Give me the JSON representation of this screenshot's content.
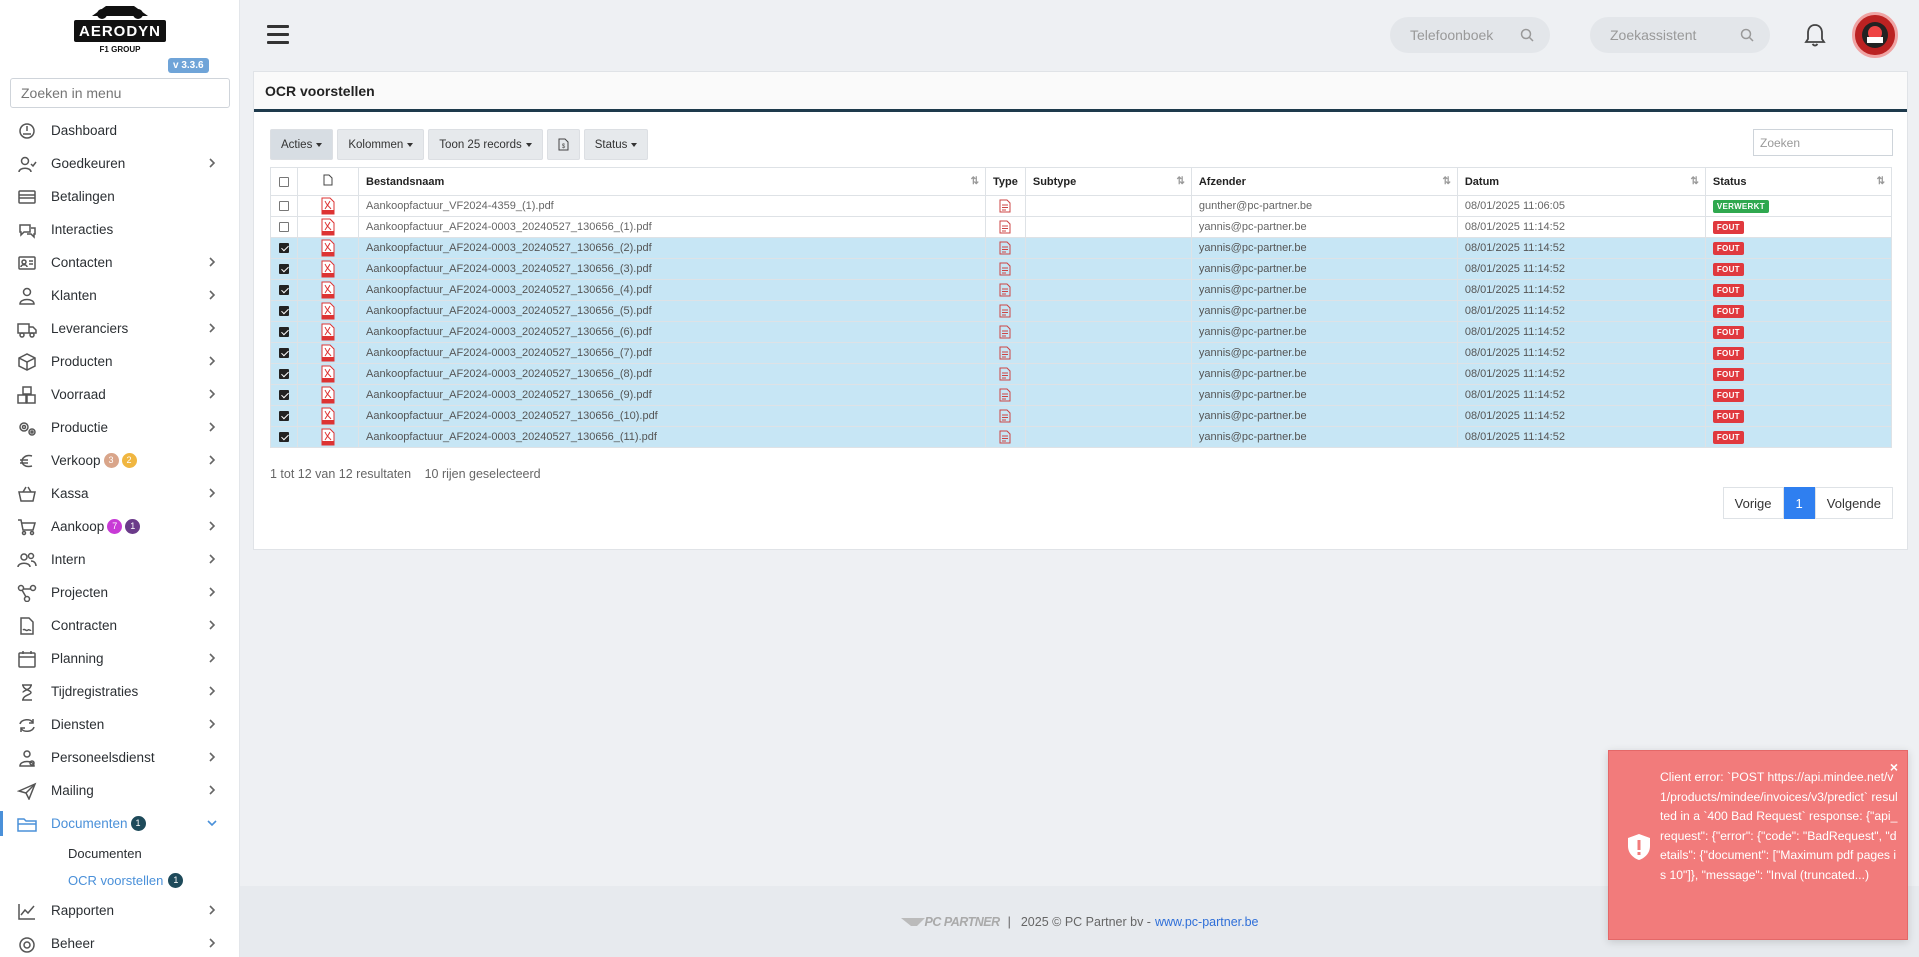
{
  "app": {
    "logo_text": "AERODYN",
    "logo_sub": "F1 GROUP",
    "version": "v 3.3.6"
  },
  "sidebar": {
    "search_placeholder": "Zoeken in menu",
    "items": [
      {
        "label": "Dashboard",
        "icon": "dashboard-icon"
      },
      {
        "label": "Goedkeuren",
        "icon": "user-check-icon"
      },
      {
        "label": "Betalingen",
        "icon": "credit-card-icon"
      },
      {
        "label": "Interacties",
        "icon": "chat-icon"
      },
      {
        "label": "Contacten",
        "icon": "contact-card-icon"
      },
      {
        "label": "Klanten",
        "icon": "user-icon"
      },
      {
        "label": "Leveranciers",
        "icon": "truck-icon"
      },
      {
        "label": "Producten",
        "icon": "box-icon"
      },
      {
        "label": "Voorraad",
        "icon": "boxes-icon"
      },
      {
        "label": "Productie",
        "icon": "gears-icon"
      },
      {
        "label": "Verkoop",
        "icon": "euro-icon",
        "badges": [
          "3",
          "2"
        ]
      },
      {
        "label": "Kassa",
        "icon": "basket-icon"
      },
      {
        "label": "Aankoop",
        "icon": "cart-icon",
        "badges": [
          "7",
          "1"
        ]
      },
      {
        "label": "Intern",
        "icon": "users-icon"
      },
      {
        "label": "Projecten",
        "icon": "project-icon"
      },
      {
        "label": "Contracten",
        "icon": "contract-icon"
      },
      {
        "label": "Planning",
        "icon": "calendar-icon"
      },
      {
        "label": "Tijdregistraties",
        "icon": "clock-icon"
      },
      {
        "label": "Diensten",
        "icon": "refresh-icon"
      },
      {
        "label": "Personeelsdienst",
        "icon": "staff-icon"
      },
      {
        "label": "Mailing",
        "icon": "send-icon"
      },
      {
        "label": "Documenten",
        "icon": "folder-icon",
        "badges": [
          "1"
        ]
      }
    ],
    "sub_items": [
      {
        "label": "Documenten"
      },
      {
        "label": "OCR voorstellen",
        "badge": "1"
      }
    ],
    "after_items": [
      {
        "label": "Rapporten",
        "icon": "chart-line-icon"
      },
      {
        "label": "Beheer",
        "icon": "settings-icon"
      }
    ],
    "badge_colors": {
      "verkoop_1": "#d9a58a",
      "verkoop_2": "#f0b640",
      "aankoop_1": "#c83ad6",
      "aankoop_2": "#6b3b8a",
      "documenten": "#1e4a5a"
    }
  },
  "topbar": {
    "phonebook_placeholder": "Telefoonboek",
    "assistant_placeholder": "Zoekassistent"
  },
  "card": {
    "title": "OCR voorstellen",
    "toolbar": {
      "actions": "Acties",
      "columns": "Kolommen",
      "show": "Toon 25 records",
      "status": "Status"
    },
    "search_placeholder": "Zoeken",
    "columns": [
      "Bestandsnaam",
      "Type",
      "Subtype",
      "Afzender",
      "Datum",
      "Status"
    ],
    "rows": [
      {
        "checked": false,
        "file": "Aankoopfactuur_VF2024-4359_(1).pdf",
        "subtype": "",
        "sender": "gunther@pc-partner.be",
        "date": "08/01/2025 11:06:05",
        "status": "VERWERKT",
        "status_kind": "ok"
      },
      {
        "checked": false,
        "file": "Aankoopfactuur_AF2024-0003_20240527_130656_(1).pdf",
        "subtype": "",
        "sender": "yannis@pc-partner.be",
        "date": "08/01/2025 11:14:52",
        "status": "FOUT",
        "status_kind": "err"
      },
      {
        "checked": true,
        "file": "Aankoopfactuur_AF2024-0003_20240527_130656_(2).pdf",
        "subtype": "",
        "sender": "yannis@pc-partner.be",
        "date": "08/01/2025 11:14:52",
        "status": "FOUT",
        "status_kind": "err"
      },
      {
        "checked": true,
        "file": "Aankoopfactuur_AF2024-0003_20240527_130656_(3).pdf",
        "subtype": "",
        "sender": "yannis@pc-partner.be",
        "date": "08/01/2025 11:14:52",
        "status": "FOUT",
        "status_kind": "err"
      },
      {
        "checked": true,
        "file": "Aankoopfactuur_AF2024-0003_20240527_130656_(4).pdf",
        "subtype": "",
        "sender": "yannis@pc-partner.be",
        "date": "08/01/2025 11:14:52",
        "status": "FOUT",
        "status_kind": "err"
      },
      {
        "checked": true,
        "file": "Aankoopfactuur_AF2024-0003_20240527_130656_(5).pdf",
        "subtype": "",
        "sender": "yannis@pc-partner.be",
        "date": "08/01/2025 11:14:52",
        "status": "FOUT",
        "status_kind": "err"
      },
      {
        "checked": true,
        "file": "Aankoopfactuur_AF2024-0003_20240527_130656_(6).pdf",
        "subtype": "",
        "sender": "yannis@pc-partner.be",
        "date": "08/01/2025 11:14:52",
        "status": "FOUT",
        "status_kind": "err"
      },
      {
        "checked": true,
        "file": "Aankoopfactuur_AF2024-0003_20240527_130656_(7).pdf",
        "subtype": "",
        "sender": "yannis@pc-partner.be",
        "date": "08/01/2025 11:14:52",
        "status": "FOUT",
        "status_kind": "err"
      },
      {
        "checked": true,
        "file": "Aankoopfactuur_AF2024-0003_20240527_130656_(8).pdf",
        "subtype": "",
        "sender": "yannis@pc-partner.be",
        "date": "08/01/2025 11:14:52",
        "status": "FOUT",
        "status_kind": "err"
      },
      {
        "checked": true,
        "file": "Aankoopfactuur_AF2024-0003_20240527_130656_(9).pdf",
        "subtype": "",
        "sender": "yannis@pc-partner.be",
        "date": "08/01/2025 11:14:52",
        "status": "FOUT",
        "status_kind": "err"
      },
      {
        "checked": true,
        "file": "Aankoopfactuur_AF2024-0003_20240527_130656_(10).pdf",
        "subtype": "",
        "sender": "yannis@pc-partner.be",
        "date": "08/01/2025 11:14:52",
        "status": "FOUT",
        "status_kind": "err"
      },
      {
        "checked": true,
        "file": "Aankoopfactuur_AF2024-0003_20240527_130656_(11).pdf",
        "subtype": "",
        "sender": "yannis@pc-partner.be",
        "date": "08/01/2025 11:14:52",
        "status": "FOUT",
        "status_kind": "err"
      }
    ],
    "result_info": "1 tot 12 van 12 resultaten",
    "selected_info": "10 rijen geselecteerd",
    "pager": {
      "prev": "Vorige",
      "current": "1",
      "next": "Volgende"
    }
  },
  "footer": {
    "brand": "PC PARTNER",
    "separator": "|",
    "copyright": "2025 © PC Partner bv -",
    "link": "www.pc-partner.be"
  },
  "toast": {
    "close": "×",
    "message": "Client error: `POST https://api.mindee.net/v1/products/mindee/invoices/v3/predict` resulted in a `400 Bad Request` response: {\"api_request\": {\"error\": {\"code\": \"BadRequest\", \"details\": {\"document\": [\"Maximum pdf pages is 10\"]}, \"message\": \"Inval (truncated...)"
  }
}
